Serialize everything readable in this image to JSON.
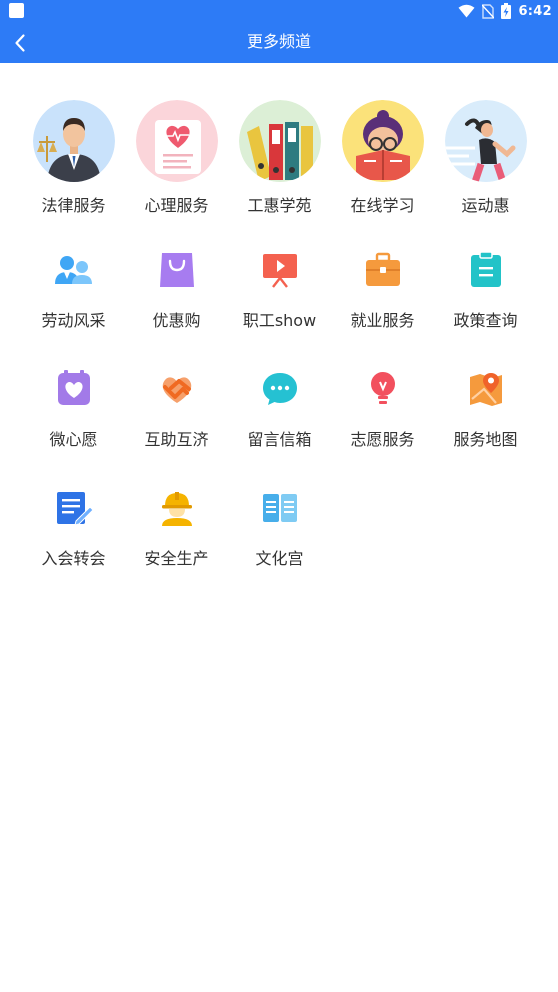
{
  "status_bar": {
    "time": "6:42"
  },
  "header": {
    "title": "更多频道"
  },
  "channels": [
    {
      "label": "法律服务",
      "icon": "lawyer-icon"
    },
    {
      "label": "心理服务",
      "icon": "heart-report-icon"
    },
    {
      "label": "工惠学苑",
      "icon": "binders-icon"
    },
    {
      "label": "在线学习",
      "icon": "reading-girl-icon"
    },
    {
      "label": "运动惠",
      "icon": "runner-icon"
    },
    {
      "label": "劳动风采",
      "icon": "workers-icon"
    },
    {
      "label": "优惠购",
      "icon": "shopping-bag-icon"
    },
    {
      "label": "职工show",
      "icon": "presentation-icon"
    },
    {
      "label": "就业服务",
      "icon": "briefcase-icon"
    },
    {
      "label": "政策查询",
      "icon": "clipboard-icon"
    },
    {
      "label": "微心愿",
      "icon": "wish-heart-icon"
    },
    {
      "label": "互助互济",
      "icon": "handshake-icon"
    },
    {
      "label": "留言信箱",
      "icon": "chat-bubble-icon"
    },
    {
      "label": "志愿服务",
      "icon": "lightbulb-icon"
    },
    {
      "label": "服务地图",
      "icon": "map-pin-icon"
    },
    {
      "label": "入会转会",
      "icon": "document-edit-icon"
    },
    {
      "label": "安全生产",
      "icon": "safety-helmet-icon"
    },
    {
      "label": "文化宫",
      "icon": "open-book-icon"
    }
  ],
  "colors": {
    "header_bg": "#2d7bf6",
    "label_text": "#333333"
  }
}
